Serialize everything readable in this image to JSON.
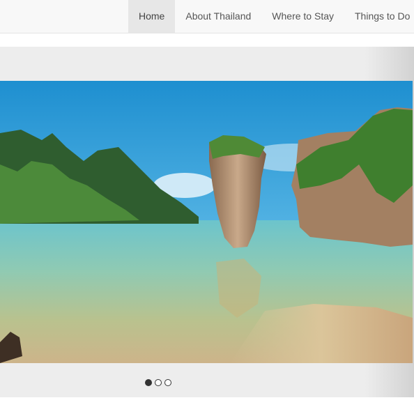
{
  "nav": {
    "items": [
      {
        "label": "Home",
        "active": true
      },
      {
        "label": "About Thailand",
        "active": false
      },
      {
        "label": "Where to Stay",
        "active": false
      },
      {
        "label": "Things to Do",
        "active": false
      }
    ]
  },
  "carousel": {
    "slide_count": 3,
    "active_index": 0
  }
}
